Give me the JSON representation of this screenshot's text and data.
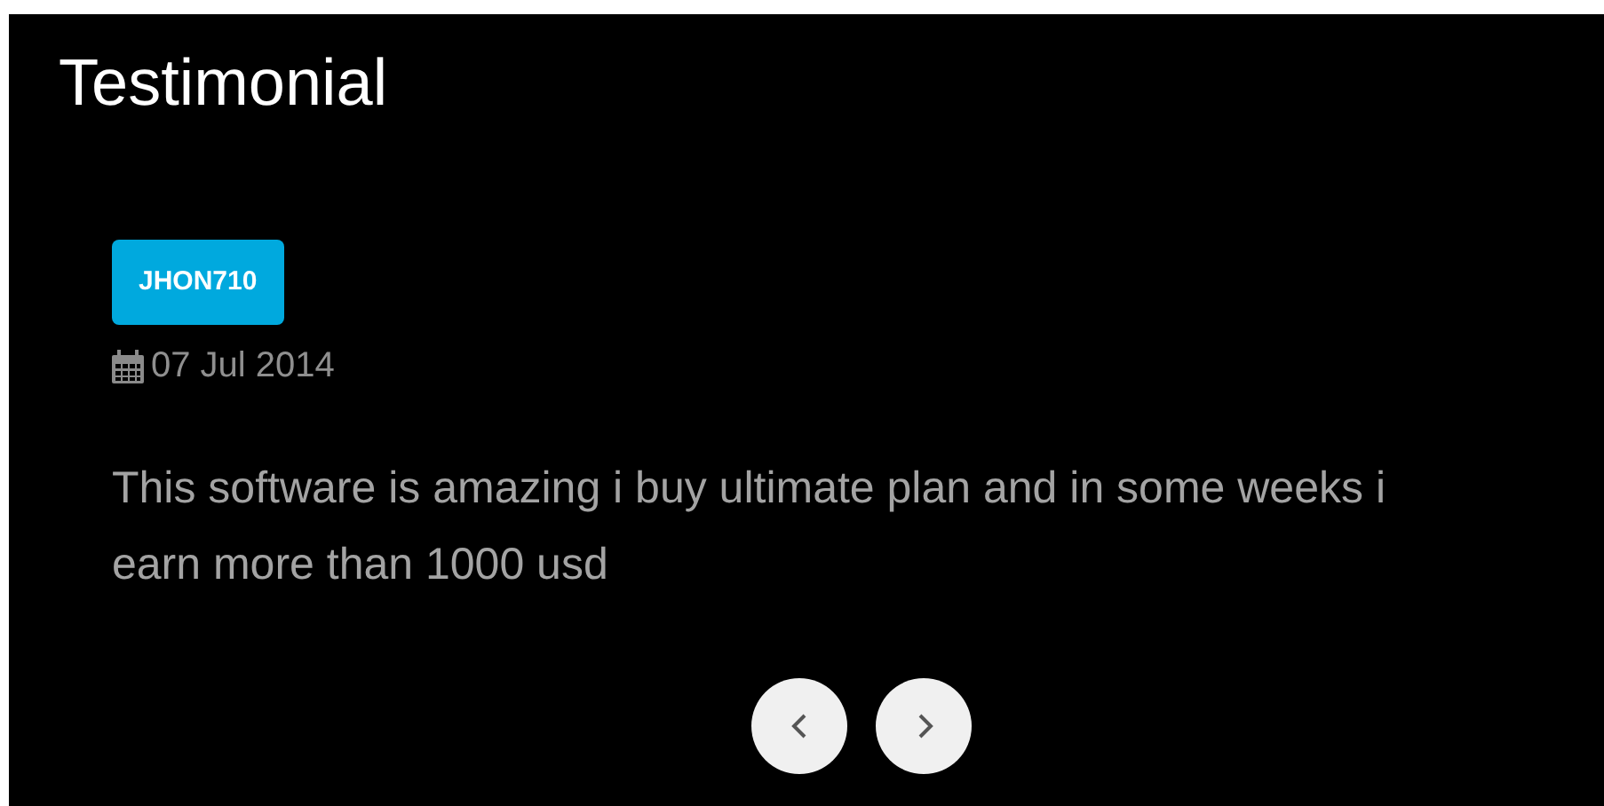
{
  "section": {
    "title": "Testimonial"
  },
  "testimonial": {
    "author": "JHON710",
    "date": "07 Jul 2014",
    "text": "This software is amazing i buy ultimate plan and in some weeks i earn more than 1000 usd"
  },
  "carousel": {
    "buttons": [
      {
        "kind": "prev"
      },
      {
        "kind": "next"
      }
    ]
  }
}
